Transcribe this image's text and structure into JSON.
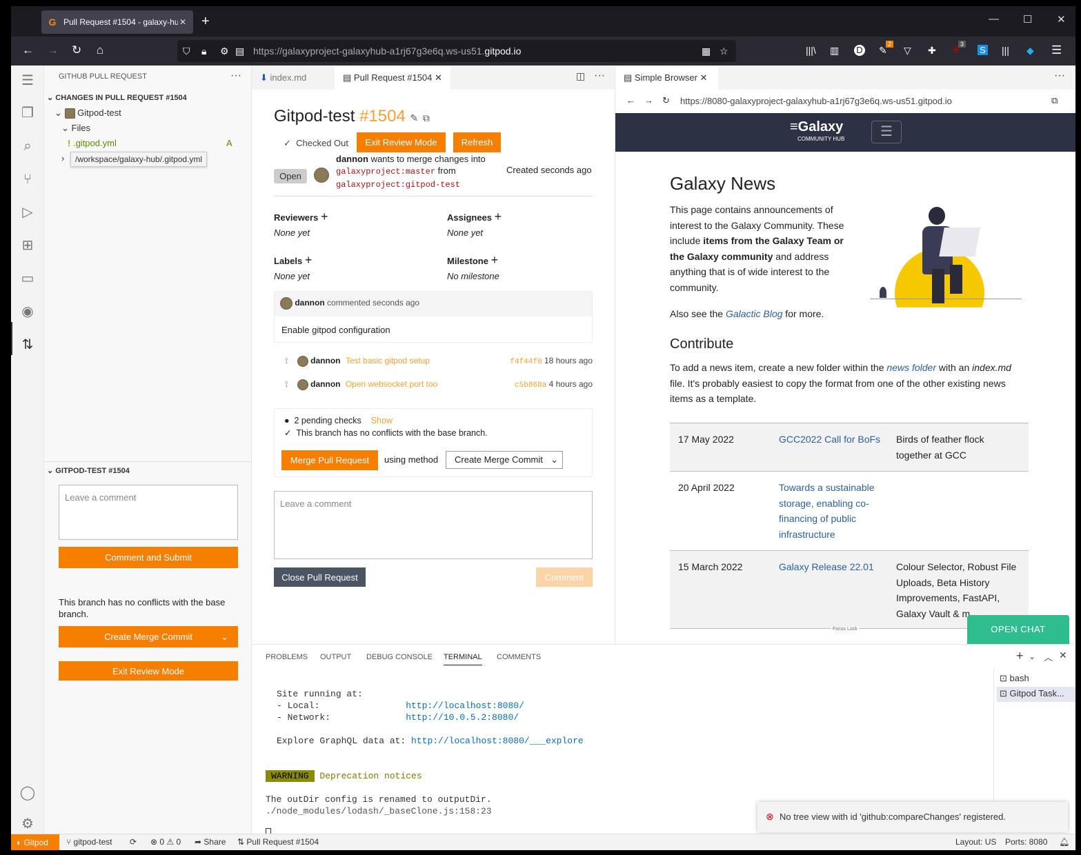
{
  "browser": {
    "tab_title": "Pull Request #1504 - galaxy-hu",
    "url_prefix": "https://galaxyproject-galaxyhub-a1rj67g3e6q.ws-us51.",
    "url_domain": "gitpod.io",
    "ext_badge_1": "2",
    "ext_badge_2": "3"
  },
  "sidebar": {
    "header": "GITHUB PULL REQUEST",
    "section_changes": "CHANGES IN PULL REQUEST #1504",
    "repo": "Gitpod-test",
    "files_label": "Files",
    "file_name": ".gitpod.yml",
    "file_status": "A",
    "tooltip": "/workspace/galaxy-hub/.gitpod.yml",
    "section_review": "GITPOD-TEST #1504",
    "comment_placeholder": "Leave a comment",
    "comment_submit": "Comment and Submit",
    "no_conflicts": "This branch has no conflicts with the base branch.",
    "merge_method": "Create Merge Commit",
    "exit_review": "Exit Review Mode"
  },
  "editor": {
    "tab_index": "index.md",
    "tab_pr": "Pull Request #1504",
    "title": "Gitpod-test",
    "number": "#1504",
    "checked_out": "Checked Out",
    "exit_review": "Exit Review Mode",
    "refresh": "Refresh",
    "state": "Open",
    "author": "dannon",
    "wants": "wants to merge changes into",
    "base": "galaxyproject:master",
    "from": "from",
    "head": "galaxyproject:gitpod-test",
    "created": "Created seconds ago",
    "reviewers": "Reviewers",
    "reviewers_val": "None yet",
    "assignees": "Assignees",
    "assignees_val": "None yet",
    "labels": "Labels",
    "labels_val": "None yet",
    "milestone": "Milestone",
    "milestone_val": "No milestone",
    "comment_author": "dannon",
    "comment_time": "commented seconds ago",
    "comment_body": "Enable gitpod configuration",
    "commits": [
      {
        "author": "dannon",
        "msg": "Test basic gitpod setup",
        "sha": "f4f44f0",
        "time": "18 hours ago"
      },
      {
        "author": "dannon",
        "msg": "Open websocket port too",
        "sha": "c5b868a",
        "time": "4 hours ago"
      }
    ],
    "checks": "2 pending checks",
    "checks_show": "Show",
    "no_conflicts": "This branch has no conflicts with the base branch.",
    "merge_button": "Merge Pull Request",
    "using_method": "using method",
    "merge_method": "Create Merge Commit",
    "comment_placeholder": "Leave a comment",
    "close_pr": "Close Pull Request",
    "comment_btn": "Comment"
  },
  "simple_browser": {
    "tab": "Simple Browser",
    "url": "https://8080-galaxyproject-galaxyhub-a1rj67g3e6q.ws-us51.gitpod.io",
    "logo": "Galaxy",
    "logo_sub": "COMMUNITY HUB",
    "news_title": "Galaxy News",
    "p1_a": "This page contains announcements of interest to the Galaxy Community. These include ",
    "p1_b": "items from the Galaxy Team or the Galaxy community",
    "p1_c": " and address anything that is of wide interest to the community.",
    "p2_a": "Also see the ",
    "p2_link": "Galactic Blog",
    "p2_c": " for more.",
    "contribute": "Contribute",
    "p3_a": "To add a news item, create a new folder within the ",
    "p3_link": "news folder",
    "p3_b": " with an ",
    "p3_file": "index.md",
    "p3_c": " file. It's probably easiest to copy the format from one of the other existing news items as a template.",
    "news": [
      {
        "date": "17 May 2022",
        "title": "GCC2022 Call for BoFs",
        "desc": "Birds of feather flock together at GCC"
      },
      {
        "date": "20 April 2022",
        "title": "Towards a sustainable storage, enabling co-financing of public infrastructure",
        "desc": ""
      },
      {
        "date": "15 March 2022",
        "title": "Galaxy Release 22.01",
        "desc": "Colour Selector, Robust File Uploads, Beta History Improvements, FastAPI, Galaxy Vault & m"
      }
    ],
    "focus_lock": "Focus Lock",
    "open_chat": "OPEN CHAT"
  },
  "panel": {
    "tabs": [
      "PROBLEMS",
      "OUTPUT",
      "DEBUG CONSOLE",
      "TERMINAL",
      "COMMENTS"
    ],
    "site_running": "Site running at:",
    "local_label": "- Local:",
    "local_url": "http://localhost:8080/",
    "network_label": "- Network:",
    "network_url": "http://10.0.5.2:8080/",
    "graphql_label": "Explore GraphQL data at: ",
    "graphql_url": "http://localhost:8080/___explore",
    "warning": "WARNING",
    "deprecation": "Deprecation notices",
    "outdir": "The outDir config is renamed to outputDir.",
    "trace": "./node_modules/lodash/_baseClone.js:158:23",
    "terminals": [
      "bash",
      "Gitpod Task..."
    ],
    "toast": "No tree view with id 'github:compareChanges' registered."
  },
  "status": {
    "gitpod": "Gitpod",
    "branch": "gitpod-test",
    "errors": "0",
    "warnings": "0",
    "share": "Share",
    "pr": "Pull Request #1504",
    "layout": "Layout: US",
    "ports": "Ports: 8080"
  }
}
